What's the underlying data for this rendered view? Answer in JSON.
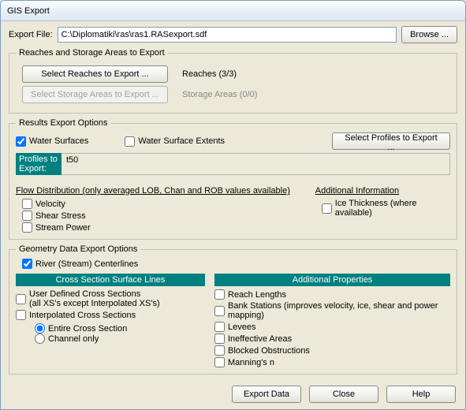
{
  "title": "GIS Export",
  "export_file_label": "Export File:",
  "export_file_value": "C:\\Diplomatiki\\ras\\ras1.RASexport.sdf",
  "browse_label": "Browse ...",
  "reaches_group": "Reaches and Storage Areas to Export",
  "select_reaches_btn": "Select Reaches to Export ...",
  "reaches_status": "Reaches (3/3)",
  "select_storage_btn": "Select Storage Areas to Export ...",
  "storage_status": "Storage Areas (0/0)",
  "results_group": "Results Export Options",
  "water_surfaces": "Water Surfaces",
  "water_surface_extents": "Water Surface Extents",
  "select_profiles_btn": "Select Profiles to Export ...",
  "profiles_label": "Profiles to Export:",
  "profiles_value": "t50",
  "flow_dist": "Flow Distribution (only averaged LOB, Chan and ROB values available)",
  "additional_info": "Additional Information",
  "velocity": "Velocity",
  "shear_stress": "Shear Stress",
  "stream_power": "Stream Power",
  "ice_thickness": "Ice Thickness (where available)",
  "geometry_group": "Geometry Data Export Options",
  "river_centerlines": "River (Stream) Centerlines",
  "xs_surface_lines": "Cross Section Surface Lines",
  "additional_props": "Additional Properties",
  "user_def_xs_l1": "User Defined Cross Sections",
  "user_def_xs_l2": "(all XS's except Interpolated XS's)",
  "interp_xs": "Interpolated Cross Sections",
  "entire_xs": "Entire Cross Section",
  "channel_only": "Channel only",
  "reach_lengths": "Reach Lengths",
  "bank_stations": "Bank Stations (improves velocity, ice, shear and power mapping)",
  "levees": "Levees",
  "ineffective": "Ineffective Areas",
  "blocked": "Blocked Obstructions",
  "mannings": "Manning's n",
  "export_btn": "Export Data",
  "close_btn": "Close",
  "help_btn": "Help"
}
